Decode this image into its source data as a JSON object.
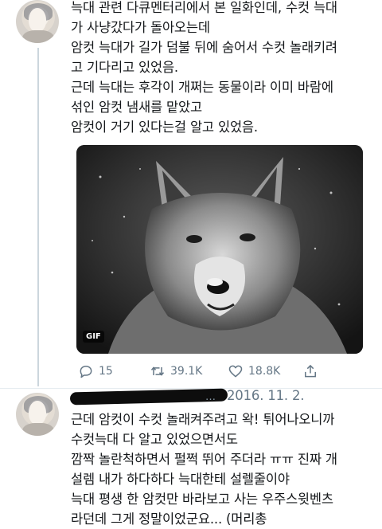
{
  "tweet1": {
    "text": "늑대 관련 다큐멘터리에서 본 일화인데, 수컷 늑대\n가 사냥갔다가 돌아오는데\n암컷 늑대가 길가 덤불 뒤에 숨어서 수컷 놀래키려\n고 기다리고 있었음.\n근데 늑대는 후각이 개쩌는 동물이라 이미 바람에\n섞인 암컷 냄새를 맡았고\n암컷이 거기 있다는걸 알고 있었음.",
    "media": {
      "badge": "GIF",
      "icon": "wolf-gif"
    },
    "actions": {
      "reply_count": "15",
      "retweet_count": "39.1K",
      "like_count": "18.8K"
    }
  },
  "tweet2": {
    "handle_tail": "…",
    "date": "2016. 11. 2.",
    "text": "근데 암컷이 수컷 놀래켜주려고 왁! 튀어나오니까\n수컷늑대 다 알고 있었으면서도\n깜짝 놀란척하면서 펄쩍 뛰어 주더라 ㅠㅠ 진짜 개\n설렘 내가 하다하다 늑대한테 설렐줄이야\n늑대 평생 한 암컷만 바라보고 사는 우주스윗벤츠\n라던데 그게 정말이었군요... (머리총"
  },
  "colors": {
    "secondary_text": "#657786",
    "divider": "#e6ecf0",
    "thread_line": "#ccd6dd"
  }
}
